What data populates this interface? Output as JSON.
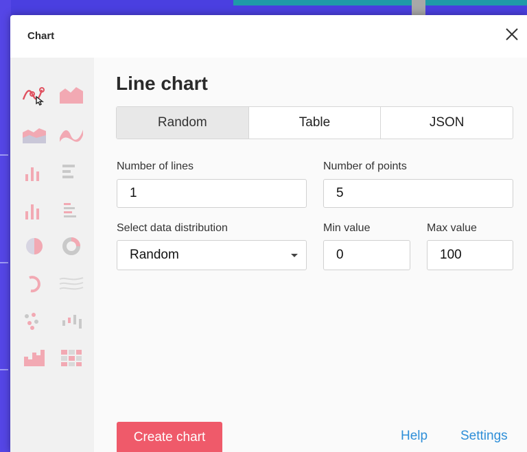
{
  "dialog": {
    "title": "Chart"
  },
  "sidebar": {
    "chart_types": [
      {
        "icon": "line-chart-icon",
        "selected": true
      },
      {
        "icon": "area-chart-icon"
      },
      {
        "icon": "stacked-area-chart-icon"
      },
      {
        "icon": "wave-area-chart-icon"
      },
      {
        "icon": "column-chart-icon"
      },
      {
        "icon": "bar-chart-icon"
      },
      {
        "icon": "grouped-column-chart-icon"
      },
      {
        "icon": "grouped-bar-chart-icon"
      },
      {
        "icon": "pie-chart-icon"
      },
      {
        "icon": "donut-chart-icon"
      },
      {
        "icon": "arc-chart-icon"
      },
      {
        "icon": "stream-chart-icon"
      },
      {
        "icon": "scatter-chart-icon"
      },
      {
        "icon": "candlestick-chart-icon"
      },
      {
        "icon": "histogram-chart-icon"
      },
      {
        "icon": "heatmap-chart-icon"
      }
    ]
  },
  "main": {
    "heading": "Line chart",
    "tabs": [
      {
        "label": "Random",
        "active": true
      },
      {
        "label": "Table"
      },
      {
        "label": "JSON"
      }
    ],
    "fields": {
      "lines_label": "Number of lines",
      "lines_value": "1",
      "points_label": "Number of points",
      "points_value": "5",
      "distribution_label": "Select data distribution",
      "distribution_value": "Random",
      "min_label": "Min value",
      "min_value": "0",
      "max_label": "Max value",
      "max_value": "100"
    },
    "create_button": "Create chart",
    "help_link": "Help",
    "settings_link": "Settings"
  },
  "colors": {
    "accent": "#ef5a6a",
    "link": "#2d8ed8",
    "icon_pink": "#f2a9b3"
  }
}
